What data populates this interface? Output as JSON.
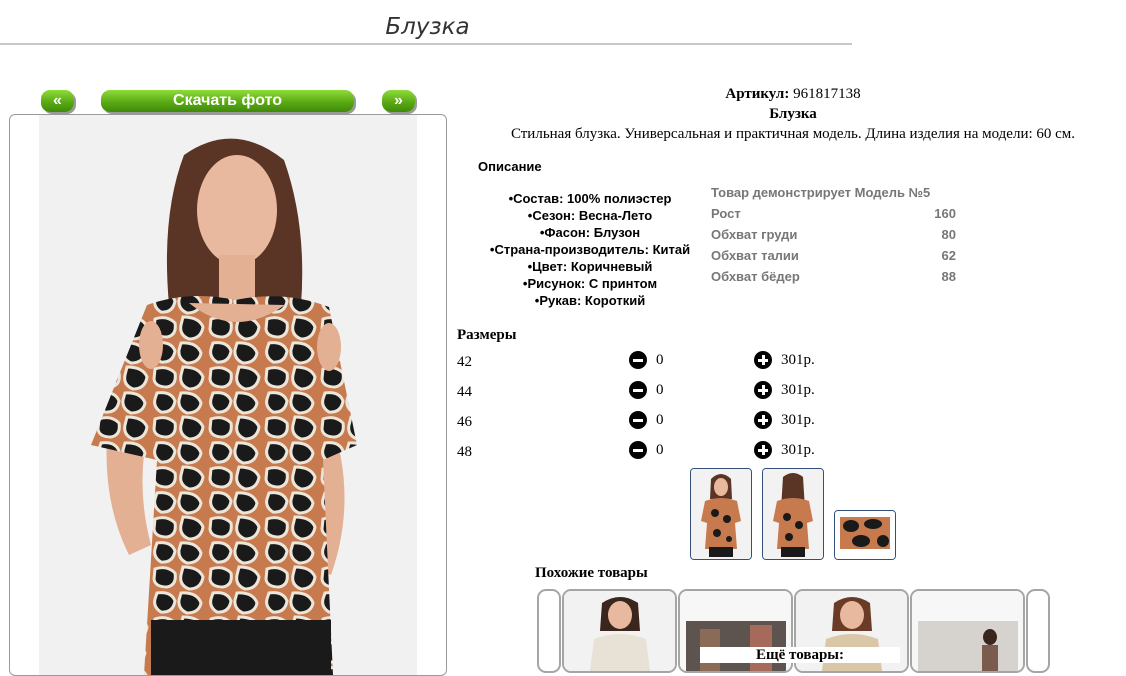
{
  "page_title": "Блузка",
  "controls": {
    "prev_label": "«",
    "download_label": "Скачать фото",
    "next_label": "»"
  },
  "product": {
    "article_label": "Артикул:",
    "article_value": "961817138",
    "name": "Блузка",
    "tagline": "Стильная блузка. Универсальная и практичная модель. Длина изделия на модели: 60 см.",
    "description_heading": "Описание",
    "attributes": [
      "Состав: 100% полиэстер",
      "Сезон: Весна-Лето",
      "Фасон: Блузон",
      "Страна-производитель: Китай",
      "Цвет: Коричневый",
      "Рисунок: С принтом",
      "Рукав: Короткий"
    ],
    "model_heading": "Товар демонстрирует Модель №5",
    "model_params": [
      {
        "label": "Рост",
        "value": "160"
      },
      {
        "label": "Обхват груди",
        "value": "80"
      },
      {
        "label": "Обхват талии",
        "value": "62"
      },
      {
        "label": "Обхват бёдер",
        "value": "88"
      }
    ]
  },
  "sizes": {
    "heading": "Размеры",
    "rows": [
      {
        "size": "42",
        "qty": "0",
        "price": "301р."
      },
      {
        "size": "44",
        "qty": "0",
        "price": "301р."
      },
      {
        "size": "46",
        "qty": "0",
        "price": "301р."
      },
      {
        "size": "48",
        "qty": "0",
        "price": "301р."
      }
    ]
  },
  "similar_heading": "Похожие товары",
  "more_heading": "Ещё товары:",
  "colors": {
    "accent_green": "#5aaa14",
    "thumb_border": "#334f7a",
    "muted_text": "#777777"
  }
}
